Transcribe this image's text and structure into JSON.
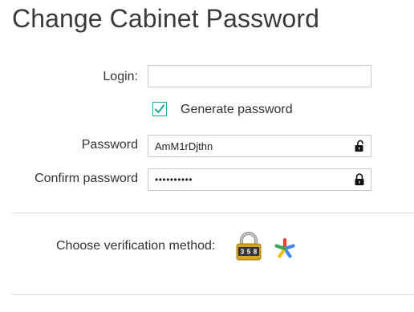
{
  "page": {
    "title": "Change Cabinet Password"
  },
  "form": {
    "login_label": "Login:",
    "login_value": "",
    "generate_password_label": "Generate password",
    "generate_password_checked": true,
    "password_label": "Password",
    "password_value": "AmM1rDjthn",
    "confirm_password_label": "Confirm password",
    "confirm_password_value": "AmM1rDjthn"
  },
  "verification": {
    "label": "Choose verification method:",
    "methods": [
      {
        "icon": "padlock-code-icon",
        "code": "358"
      },
      {
        "icon": "google-authenticator-icon"
      }
    ]
  },
  "colors": {
    "accent": "#2aa6a0",
    "padlock_gold": "#d9a520"
  }
}
